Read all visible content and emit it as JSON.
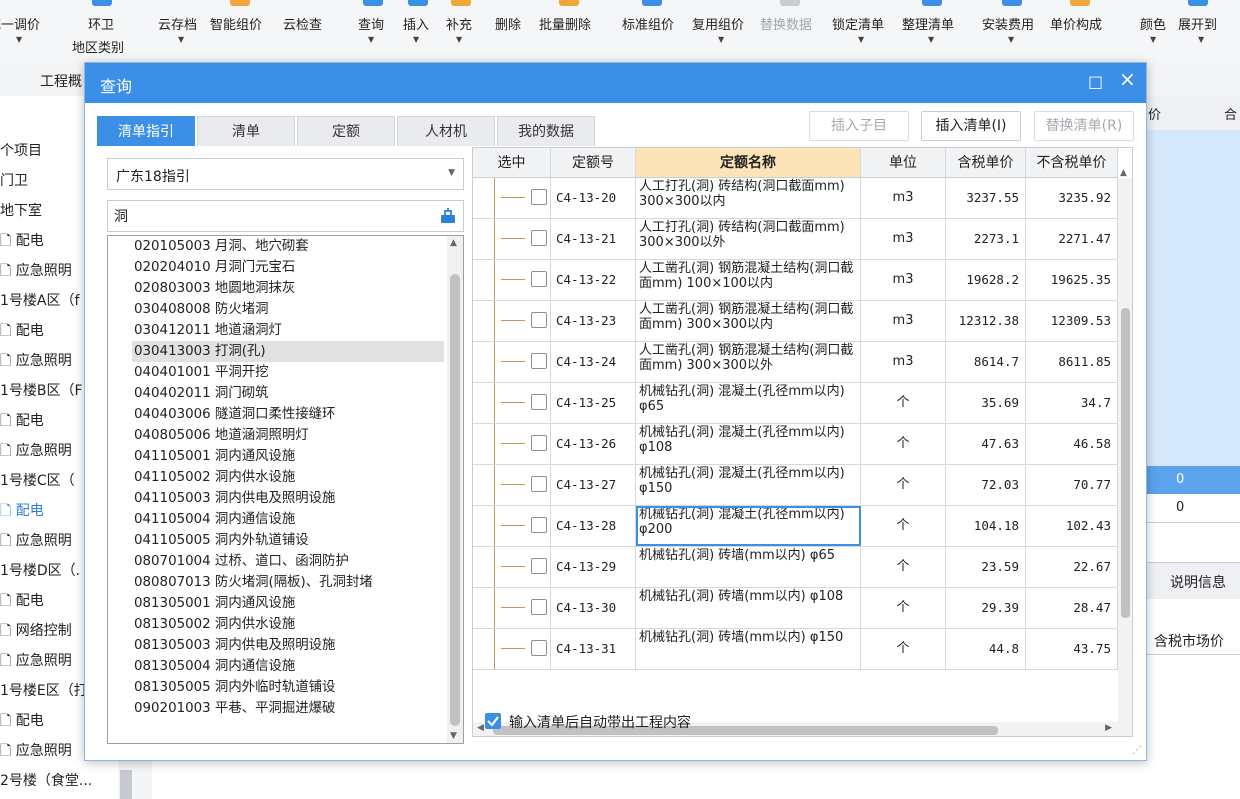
{
  "toolbar": {
    "items": [
      {
        "label": "统一调价",
        "label2": ""
      },
      {
        "label": "环卫",
        "label2": "地区类别"
      },
      {
        "label": "云存档",
        "label2": ""
      },
      {
        "label": "智能组价",
        "label2": ""
      },
      {
        "label": "云检查",
        "label2": ""
      },
      {
        "label": "查询",
        "label2": ""
      },
      {
        "label": "插入",
        "label2": ""
      },
      {
        "label": "补充",
        "label2": ""
      },
      {
        "label": "删除",
        "label2": ""
      },
      {
        "label": "批量删除",
        "label2": ""
      },
      {
        "label": "标准组价",
        "label2": ""
      },
      {
        "label": "复用组价",
        "label2": ""
      },
      {
        "label": "替换数据",
        "label2": ""
      },
      {
        "label": "锁定清单",
        "label2": ""
      },
      {
        "label": "整理清单",
        "label2": ""
      },
      {
        "label": "安装费用",
        "label2": ""
      },
      {
        "label": "单价构成",
        "label2": ""
      },
      {
        "label": "颜色",
        "label2": ""
      },
      {
        "label": "展开到",
        "label2": ""
      }
    ]
  },
  "background": {
    "tab_label": "工程概",
    "tree": [
      "个项目",
      "门卫",
      "地下室",
      "配电",
      "应急照明",
      "1号楼A区（f",
      "配电",
      "应急照明",
      "1号楼B区（F",
      "配电",
      "应急照明",
      "1号楼C区（",
      "配电",
      "应急照明",
      "1号楼D区（.",
      "配电",
      "网络控制",
      "应急照明",
      "1号楼E区（打",
      "配电",
      "应急照明",
      "2号楼（食堂..."
    ],
    "right_header": "合",
    "right_header2": "价",
    "right_values": [
      "0",
      "0"
    ],
    "right_tab": "说明信息",
    "right_col": "含税市场价"
  },
  "dialog": {
    "title": "查询",
    "minimize": "□",
    "close": "×",
    "tabs": [
      "清单指引",
      "清单",
      "定额",
      "人材机",
      "我的数据"
    ],
    "buttons": {
      "insert_child": "插入子目",
      "insert_list": "插入清单(I)",
      "replace_list": "替换清单(R)"
    },
    "guide_select": "广东18指引",
    "search_value": "洞",
    "list": [
      "020105003  月洞、地穴砌套",
      "020204010  月洞门元宝石",
      "020803003  地圆地洞抹灰",
      "030408008  防火堵洞",
      "030412011  地道涵洞灯",
      "030413003  打洞(孔)",
      "040401001  平洞开挖",
      "040402011  洞门砌筑",
      "040403006  隧道洞口柔性接缝环",
      "040805006  地道涵洞照明灯",
      "041105001  洞内通风设施",
      "041105002  洞内供水设施",
      "041105003  洞内供电及照明设施",
      "041105004  洞内通信设施",
      "041105005  洞内外轨道铺设",
      "080701004  过桥、道口、函洞防护",
      "080807013  防火堵洞(隔板)、孔洞封堵",
      "081305001  洞内通风设施",
      "081305002  洞内供水设施",
      "081305003  洞内供电及照明设施",
      "081305004  洞内通信设施",
      "081305005  洞内外临时轨道铺设",
      "090201003  平巷、平洞掘进爆破"
    ],
    "grid": {
      "headers": [
        "选中",
        "定额号",
        "定额名称",
        "单位",
        "含税单价",
        "不含税单价"
      ],
      "rows": [
        {
          "code": "C4-13-20",
          "name": "人工打孔(洞) 砖结构(洞口截面mm) 300×300以内",
          "unit": "m3",
          "tax": "3237.55",
          "notax": "3235.92"
        },
        {
          "code": "C4-13-21",
          "name": "人工打孔(洞) 砖结构(洞口截面mm) 300×300以外",
          "unit": "m3",
          "tax": "2273.1",
          "notax": "2271.47"
        },
        {
          "code": "C4-13-22",
          "name": "人工凿孔(洞) 钢筋混凝土结构(洞口截面mm) 100×100以内",
          "unit": "m3",
          "tax": "19628.2",
          "notax": "19625.35"
        },
        {
          "code": "C4-13-23",
          "name": "人工凿孔(洞) 钢筋混凝土结构(洞口截面mm) 300×300以内",
          "unit": "m3",
          "tax": "12312.38",
          "notax": "12309.53"
        },
        {
          "code": "C4-13-24",
          "name": "人工凿孔(洞) 钢筋混凝土结构(洞口截面mm) 300×300以外",
          "unit": "m3",
          "tax": "8614.7",
          "notax": "8611.85"
        },
        {
          "code": "C4-13-25",
          "name": "机械钻孔(洞) 混凝土(孔径mm以内) φ65",
          "unit": "个",
          "tax": "35.69",
          "notax": "34.7"
        },
        {
          "code": "C4-13-26",
          "name": "机械钻孔(洞) 混凝土(孔径mm以内) φ108",
          "unit": "个",
          "tax": "47.63",
          "notax": "46.58"
        },
        {
          "code": "C4-13-27",
          "name": "机械钻孔(洞) 混凝土(孔径mm以内) φ150",
          "unit": "个",
          "tax": "72.03",
          "notax": "70.77"
        },
        {
          "code": "C4-13-28",
          "name": "机械钻孔(洞) 混凝土(孔径mm以内) φ200",
          "unit": "个",
          "tax": "104.18",
          "notax": "102.43"
        },
        {
          "code": "C4-13-29",
          "name": "机械钻孔(洞) 砖墙(mm以内) φ65",
          "unit": "个",
          "tax": "23.59",
          "notax": "22.67"
        },
        {
          "code": "C4-13-30",
          "name": "机械钻孔(洞) 砖墙(mm以内) φ108",
          "unit": "个",
          "tax": "29.39",
          "notax": "28.47"
        },
        {
          "code": "C4-13-31",
          "name": "机械钻孔(洞) 砖墙(mm以内) φ150",
          "unit": "个",
          "tax": "44.8",
          "notax": "43.75"
        }
      ]
    },
    "auto_option": "输入清单后自动带出工程内容"
  },
  "colors": {
    "accent": "#3b8fe6",
    "header_highlight": "#fde3b8",
    "tree_line": "#c49a5a"
  }
}
